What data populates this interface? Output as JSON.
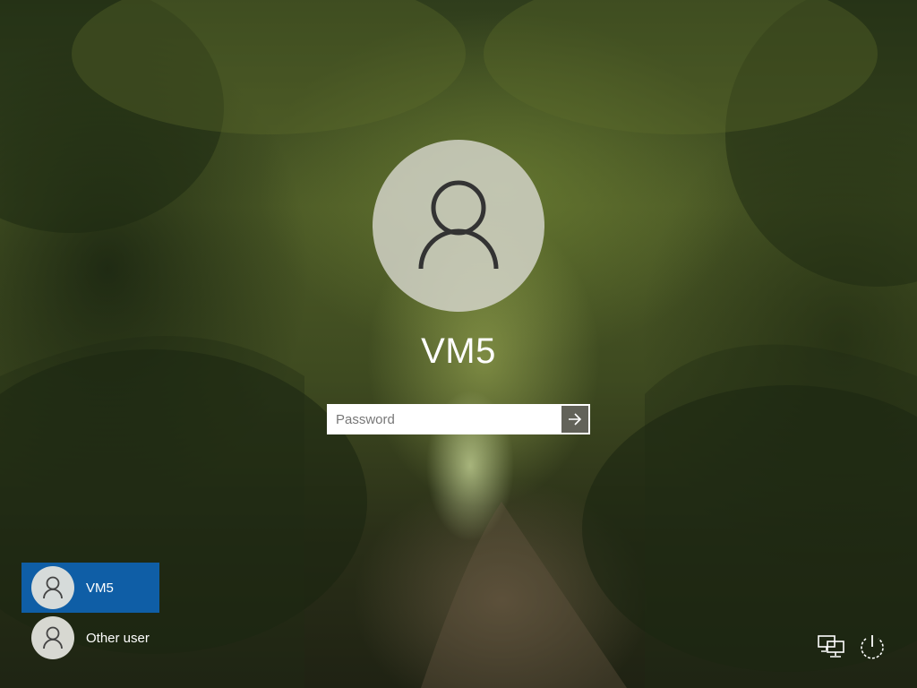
{
  "user": {
    "name": "VM5"
  },
  "password": {
    "placeholder": "Password",
    "value": ""
  },
  "user_list": [
    {
      "name": "VM5",
      "selected": true
    },
    {
      "name": "Other user",
      "selected": false
    }
  ],
  "icons": {
    "avatar": "user-silhouette-icon",
    "submit": "arrow-right-icon",
    "network": "network-icon",
    "power": "power-icon"
  },
  "colors": {
    "selected_user_bg": "#0f5ea6",
    "text": "#ffffff"
  }
}
